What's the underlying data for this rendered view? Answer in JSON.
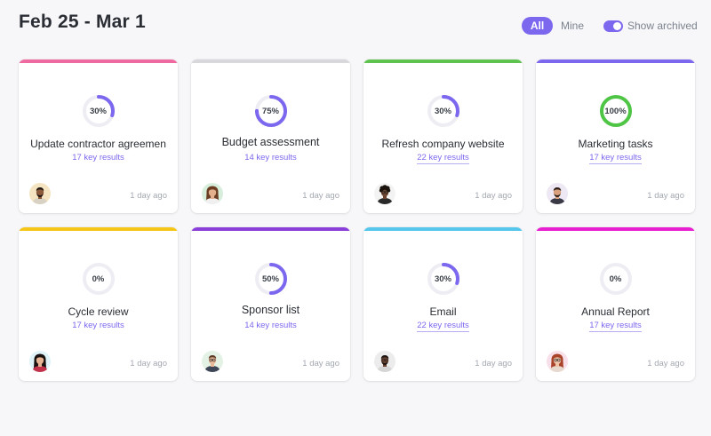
{
  "header": {
    "title": "Feb 25 - Mar 1",
    "filter_all": "All",
    "filter_mine": "Mine",
    "show_archived": "Show archived"
  },
  "colors": {
    "accent": "#7b68ee",
    "complete": "#4fc546"
  },
  "cards": [
    {
      "name": "Update contractor agreemen",
      "percent_label": "30%",
      "progress": 0.3,
      "key_results": "17 key results",
      "time": "1 day ago",
      "bar_color": "#f06aa2",
      "avatar": "avatar-man-beard",
      "keys_underlined": false,
      "large": false
    },
    {
      "name": "Budget assessment",
      "percent_label": "75%",
      "progress": 0.75,
      "key_results": "14 key results",
      "time": "1 day ago",
      "bar_color": "#d8d8dc",
      "avatar": "avatar-woman-smiling",
      "keys_underlined": false,
      "large": true
    },
    {
      "name": "Refresh company website",
      "percent_label": "30%",
      "progress": 0.3,
      "key_results": "22 key results",
      "time": "1 day ago",
      "bar_color": "#5ec44f",
      "avatar": "avatar-man-curly",
      "keys_underlined": true,
      "large": false
    },
    {
      "name": "Marketing tasks",
      "percent_label": "100%",
      "progress": 1.0,
      "key_results": "17 key results",
      "time": "1 day ago",
      "bar_color": "#7b68ee",
      "avatar": "avatar-man-suit",
      "keys_underlined": true,
      "large": false
    },
    {
      "name": "Cycle review",
      "percent_label": "0%",
      "progress": 0.0,
      "key_results": "17 key results",
      "time": "1 day ago",
      "bar_color": "#f5c518",
      "avatar": "avatar-woman-dark-hair",
      "keys_underlined": false,
      "large": false
    },
    {
      "name": "Sponsor list",
      "percent_label": "50%",
      "progress": 0.5,
      "key_results": "14 key results",
      "time": "1 day ago",
      "bar_color": "#8b3fd9",
      "avatar": "avatar-man-glasses",
      "keys_underlined": false,
      "large": true
    },
    {
      "name": "Email",
      "percent_label": "30%",
      "progress": 0.3,
      "key_results": "22 key results",
      "time": "1 day ago",
      "bar_color": "#55c7ec",
      "avatar": "avatar-man-glasses-dark",
      "keys_underlined": true,
      "large": false
    },
    {
      "name": "Annual Report",
      "percent_label": "0%",
      "progress": 0.0,
      "key_results": "17 key results",
      "time": "1 day ago",
      "bar_color": "#e81fd1",
      "avatar": "avatar-woman-red-hair",
      "keys_underlined": true,
      "large": false
    }
  ]
}
